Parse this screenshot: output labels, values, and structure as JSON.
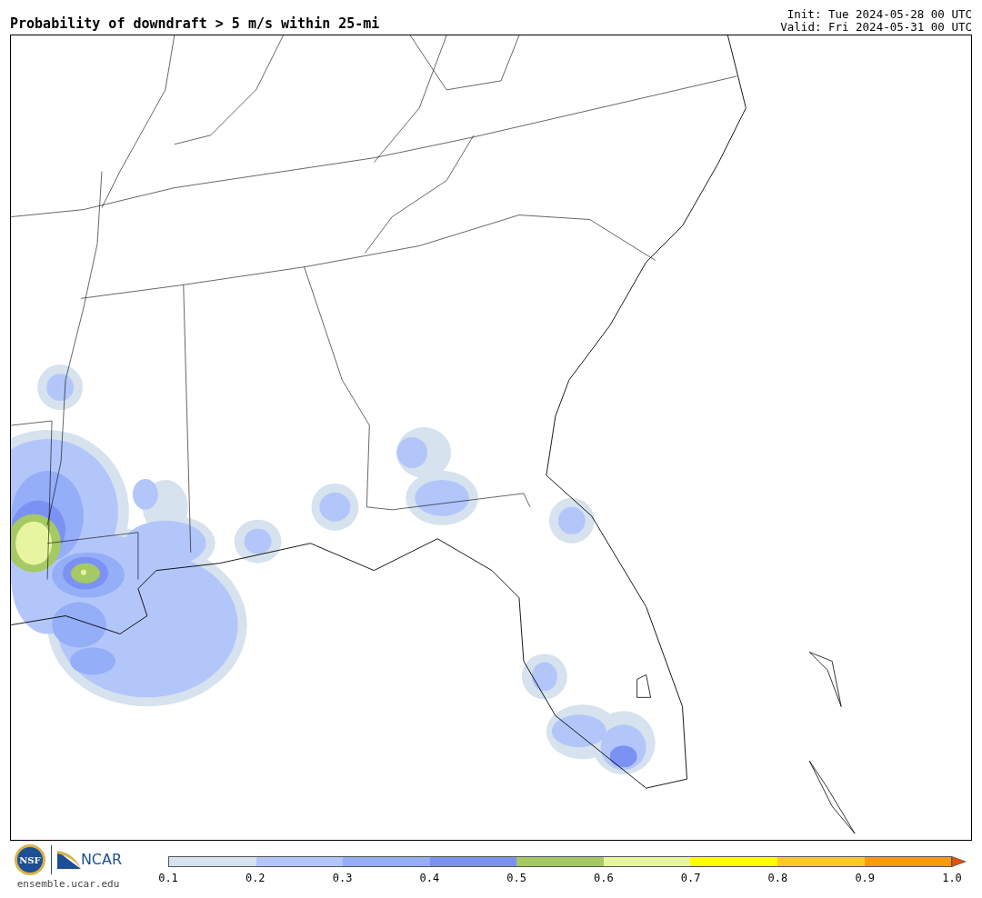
{
  "title": "Probability of downdraft > 5 m/s within 25-mi",
  "init": "Init: Tue 2024-05-28 00 UTC",
  "valid": "Valid: Fri 2024-05-31 00 UTC",
  "logos": {
    "nsf": "NSF",
    "ncar": "NCAR",
    "url": "ensemble.ucar.edu"
  },
  "colorbar": {
    "bins": [
      {
        "color": "#d6e2ed"
      },
      {
        "color": "#b3c6fa"
      },
      {
        "color": "#94aef8"
      },
      {
        "color": "#7b92f3"
      },
      {
        "color": "#a5c963"
      },
      {
        "color": "#e8f5a0"
      },
      {
        "color": "#ffff00"
      },
      {
        "color": "#ffc92a"
      },
      {
        "color": "#fb9a10"
      }
    ],
    "extend": {
      "color": "#e8500a"
    },
    "ticks": [
      "0.1",
      "0.2",
      "0.3",
      "0.4",
      "0.5",
      "0.6",
      "0.7",
      "0.8",
      "0.9",
      "1.0"
    ]
  }
}
